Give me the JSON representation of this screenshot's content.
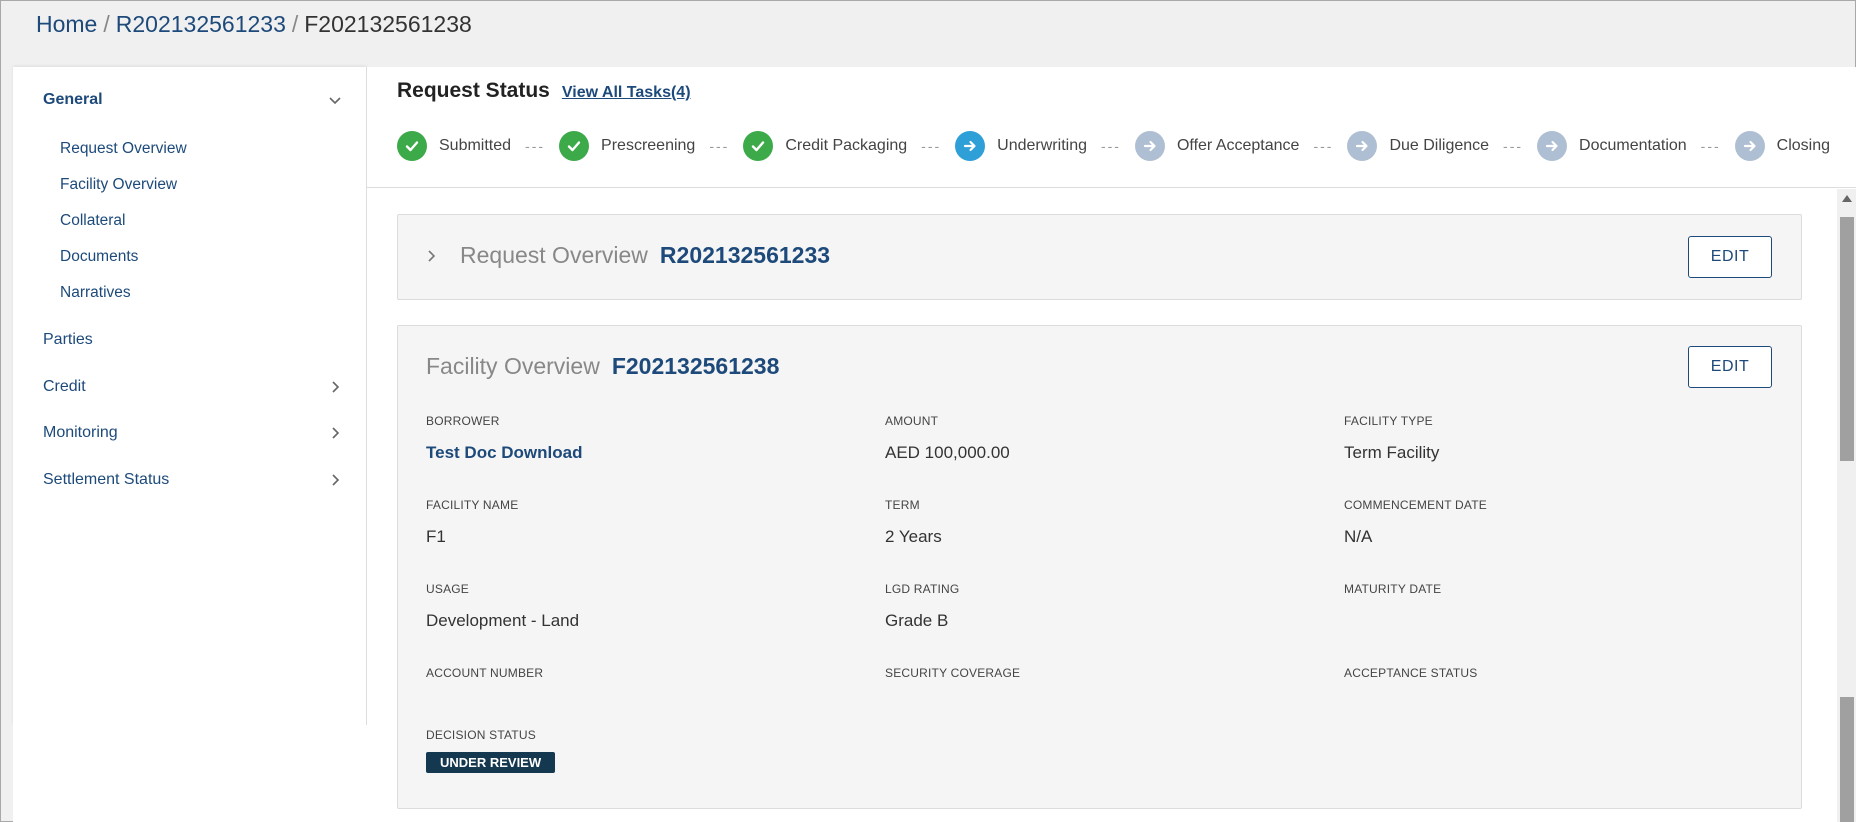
{
  "breadcrumb": {
    "home": "Home",
    "request": "R202132561233",
    "current": "F202132561238",
    "sep": "/"
  },
  "sidebar": {
    "general": "General",
    "sub_items": [
      "Request Overview",
      "Facility Overview",
      "Collateral",
      "Documents",
      "Narratives"
    ],
    "parties": "Parties",
    "credit": "Credit",
    "monitoring": "Monitoring",
    "settlement": "Settlement Status"
  },
  "status": {
    "title": "Request Status",
    "view_tasks": "View All Tasks(4)",
    "steps": [
      {
        "label": "Submitted",
        "state": "done"
      },
      {
        "label": "Prescreening",
        "state": "done"
      },
      {
        "label": "Credit Packaging",
        "state": "done"
      },
      {
        "label": "Underwriting",
        "state": "current"
      },
      {
        "label": "Offer Acceptance",
        "state": "pending"
      },
      {
        "label": "Due Diligence",
        "state": "pending"
      },
      {
        "label": "Documentation",
        "state": "pending"
      },
      {
        "label": "Closing",
        "state": "pending"
      }
    ],
    "connector": "---"
  },
  "request_overview": {
    "title": "Request Overview",
    "id": "R202132561233",
    "edit": "EDIT"
  },
  "facility_overview": {
    "title": "Facility Overview",
    "id": "F202132561238",
    "edit": "EDIT",
    "fields": {
      "borrower": {
        "label": "BORROWER",
        "value": "Test Doc Download"
      },
      "amount": {
        "label": "AMOUNT",
        "value": "AED 100,000.00"
      },
      "facility_type": {
        "label": "FACILITY TYPE",
        "value": "Term Facility"
      },
      "facility_name": {
        "label": "FACILITY NAME",
        "value": "F1"
      },
      "term": {
        "label": "TERM",
        "value": "2 Years"
      },
      "commencement_date": {
        "label": "COMMENCEMENT DATE",
        "value": "N/A"
      },
      "usage": {
        "label": "USAGE",
        "value": "Development - Land"
      },
      "lgd_rating": {
        "label": "LGD RATING",
        "value": "Grade B"
      },
      "maturity_date": {
        "label": "MATURITY DATE",
        "value": ""
      },
      "account_number": {
        "label": "ACCOUNT NUMBER",
        "value": ""
      },
      "security_coverage": {
        "label": "SECURITY COVERAGE",
        "value": ""
      },
      "acceptance_status": {
        "label": "ACCEPTANCE STATUS",
        "value": ""
      },
      "decision_status": {
        "label": "DECISION STATUS",
        "value": "UNDER REVIEW"
      }
    }
  },
  "colors": {
    "brand": "#1d4a7a",
    "done": "#3daa4a",
    "current": "#2f9fd8",
    "pending": "#afbfd3",
    "badge": "#14384f"
  }
}
